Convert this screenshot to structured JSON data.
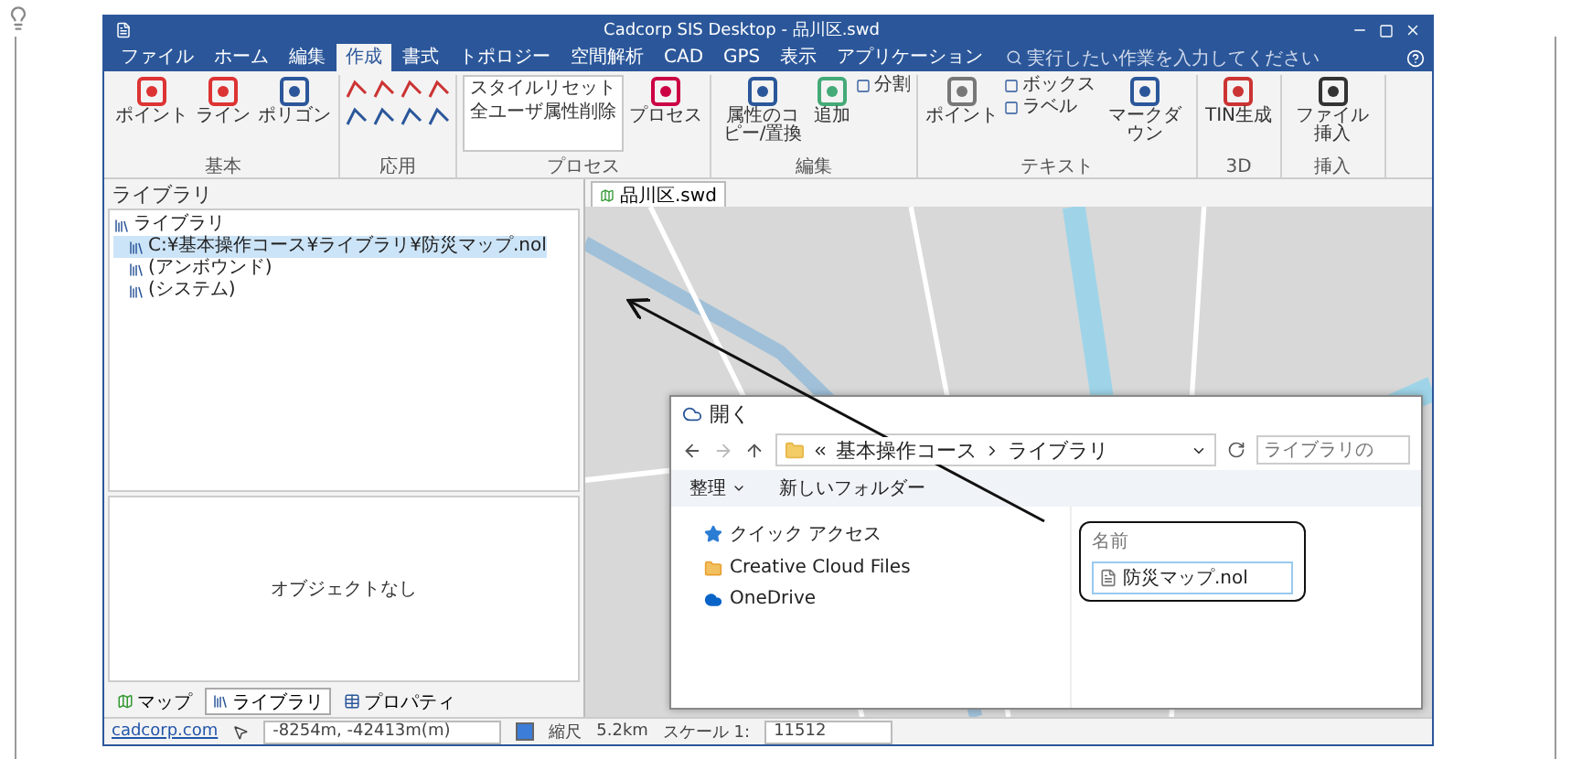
{
  "window": {
    "title": "Cadcorp SIS Desktop - 品川区.swd"
  },
  "ribbon_tabs": [
    {
      "label": "ファイル",
      "selected": false
    },
    {
      "label": "ホーム",
      "selected": false
    },
    {
      "label": "編集",
      "selected": false
    },
    {
      "label": "作成",
      "selected": true
    },
    {
      "label": "書式",
      "selected": false
    },
    {
      "label": "トポロジー",
      "selected": false
    },
    {
      "label": "空間解析",
      "selected": false
    },
    {
      "label": "CAD",
      "selected": false
    },
    {
      "label": "GPS",
      "selected": false
    },
    {
      "label": "表示",
      "selected": false
    },
    {
      "label": "アプリケーション",
      "selected": false
    }
  ],
  "tell_me": {
    "placeholder": "実行したい作業を入力してください"
  },
  "ribbon_groups": [
    {
      "caption": "基本",
      "items": [
        {
          "kind": "large",
          "label": "ポイント"
        },
        {
          "kind": "large",
          "label": "ライン"
        },
        {
          "kind": "large",
          "label": "ポリゴン"
        }
      ]
    },
    {
      "caption": "応用",
      "items": [
        {
          "kind": "icongrid"
        }
      ]
    },
    {
      "caption": "プロセス",
      "items": [
        {
          "kind": "gallery",
          "entries": [
            "スタイルリセット",
            "全ユーザ属性削除"
          ]
        },
        {
          "kind": "large",
          "label": "プロセス"
        }
      ]
    },
    {
      "caption": "編集",
      "items": [
        {
          "kind": "large",
          "label": "属性のコピー/置換"
        },
        {
          "kind": "large",
          "label": "追加"
        },
        {
          "kind": "small",
          "entries": [
            "分割"
          ]
        }
      ]
    },
    {
      "caption": "テキスト",
      "items": [
        {
          "kind": "large",
          "label": "ポイント"
        },
        {
          "kind": "small",
          "entries": [
            "ボックス",
            "ラベル"
          ]
        },
        {
          "kind": "large",
          "label": "マークダウン"
        }
      ]
    },
    {
      "caption": "3D",
      "items": [
        {
          "kind": "large",
          "label": "TIN生成"
        }
      ]
    },
    {
      "caption": "挿入",
      "items": [
        {
          "kind": "large",
          "label": "ファイル挿入"
        }
      ]
    }
  ],
  "library_panel": {
    "title": "ライブラリ",
    "tree": [
      {
        "label": "ライブラリ",
        "selected": false,
        "children": [
          {
            "label": "C:¥基本操作コース¥ライブラリ¥防災マップ.nol",
            "selected": true
          },
          {
            "label": "(アンボウンド)",
            "selected": false
          },
          {
            "label": "(システム)",
            "selected": false
          }
        ]
      }
    ],
    "empty_text": "オブジェクトなし",
    "tabs": [
      {
        "label": "マップ",
        "selected": false
      },
      {
        "label": "ライブラリ",
        "selected": true
      },
      {
        "label": "プロパティ",
        "selected": false
      }
    ]
  },
  "map_tab": {
    "label": "品川区.swd"
  },
  "status_bar": {
    "link": "cadcorp.com",
    "coordinates": "-8254m, -42413m(m)",
    "check_label": "縮尺",
    "checked": true,
    "distance": "5.2km",
    "scale_label": "スケール 1:",
    "scale_value": "11512"
  },
  "dialog": {
    "title": "開く",
    "path": [
      "基本操作コース",
      "ライブラリ"
    ],
    "search": {
      "placeholder": "ライブラリの"
    },
    "toolbar": [
      "整理",
      "新しいフォルダー"
    ],
    "nav": [
      {
        "label": "クイック アクセス"
      },
      {
        "label": "Creative Cloud Files"
      },
      {
        "label": "OneDrive"
      }
    ],
    "column": "名前",
    "files": [
      "防災マップ.nol"
    ]
  }
}
